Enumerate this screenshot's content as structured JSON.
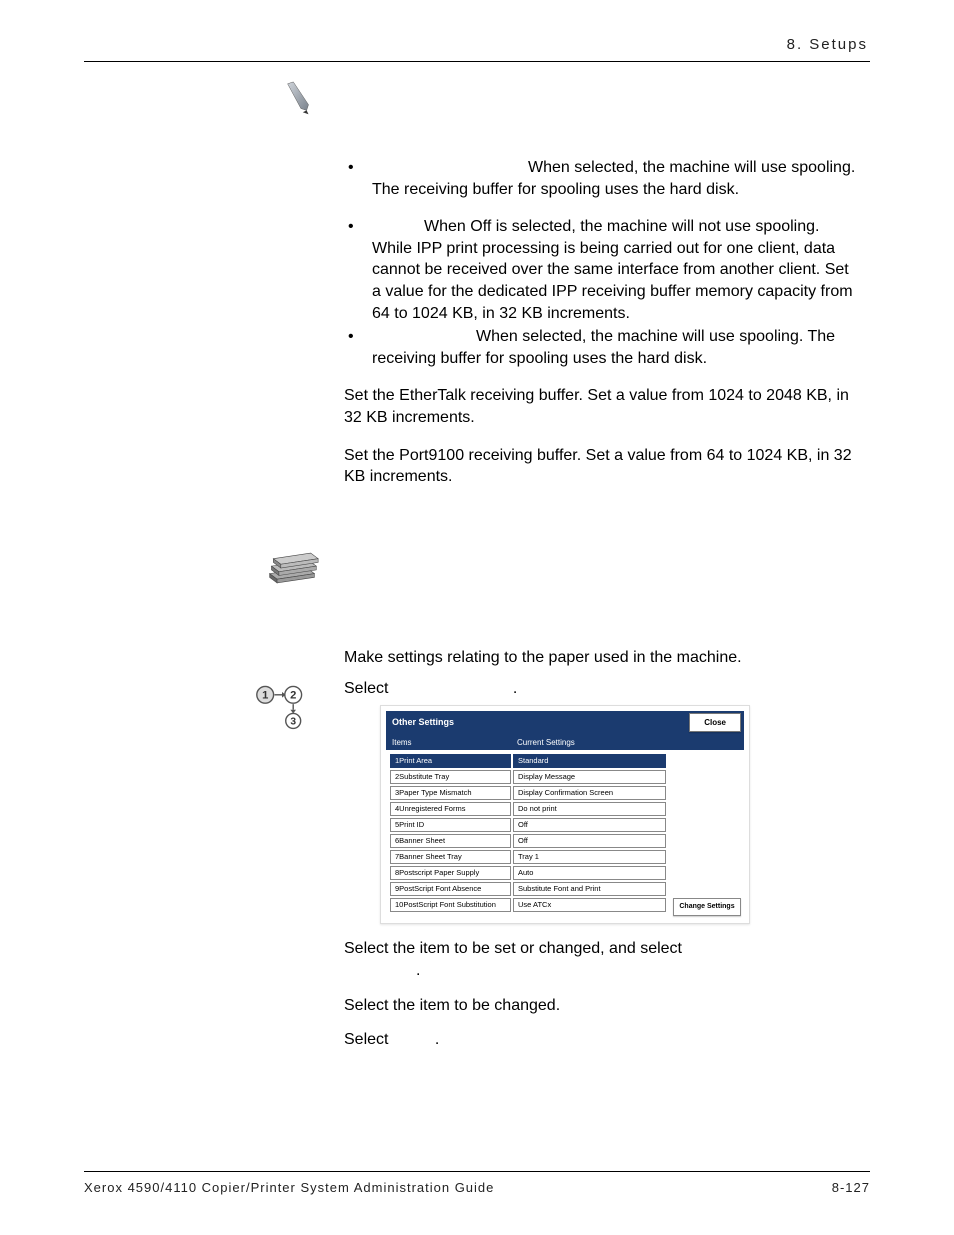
{
  "header": {
    "section": "8. Setups"
  },
  "body": {
    "bullet1": "When selected, the machine will use spooling. The receiving buffer for spooling uses the hard disk.",
    "bullet2": "When Off is selected, the machine will not use spooling. While IPP print processing is being carried out for one client, data cannot be received over the same interface from another client. Set a value for the dedicated IPP receiving buffer memory capacity from 64 to 1024 KB, in 32 KB increments.",
    "bullet3": "When selected, the machine will use spooling. The receiving buffer for spooling uses the hard disk.",
    "para_ethertalk": "Set the EtherTalk receiving buffer.  Set a value from 1024 to 2048 KB, in 32 KB increments.",
    "para_port9100": "Set the Port9100 receiving buffer.  Set a value from 64 to 1024 KB, in 32 KB increments."
  },
  "section2": {
    "intro": "Make settings relating to the paper used in the machine.",
    "step1_pre": "Select ",
    "step1_post": ".",
    "step2": "Select the item to be set or changed, and select",
    "step2b": ".",
    "step3": "Select the item to be changed.",
    "step4_pre": "Select ",
    "step4_post": "."
  },
  "screenshot": {
    "title": "Other Settings",
    "close": "Close",
    "col1": "Items",
    "col2": "Current Settings",
    "rows": [
      {
        "a": "1Print Area",
        "b": "Standard",
        "sel": true
      },
      {
        "a": "2Substitute Tray",
        "b": "Display Message"
      },
      {
        "a": "3Paper Type Mismatch",
        "b": "Display Confirmation Screen"
      },
      {
        "a": "4Unregistered Forms",
        "b": "Do not print"
      },
      {
        "a": "5Print ID",
        "b": "Off"
      },
      {
        "a": "6Banner Sheet",
        "b": "Off"
      },
      {
        "a": "7Banner Sheet Tray",
        "b": "Tray 1"
      },
      {
        "a": "8Postscript Paper Supply",
        "b": "Auto"
      },
      {
        "a": "9PostScript Font Absence",
        "b": "Substitute Font and Print"
      },
      {
        "a": "10PostScript Font Substitution",
        "b": "Use ATCx"
      }
    ],
    "change": "Change Settings"
  },
  "footer": {
    "left": "Xerox 4590/4110 Copier/Printer System Administration Guide",
    "right": "8-127"
  }
}
